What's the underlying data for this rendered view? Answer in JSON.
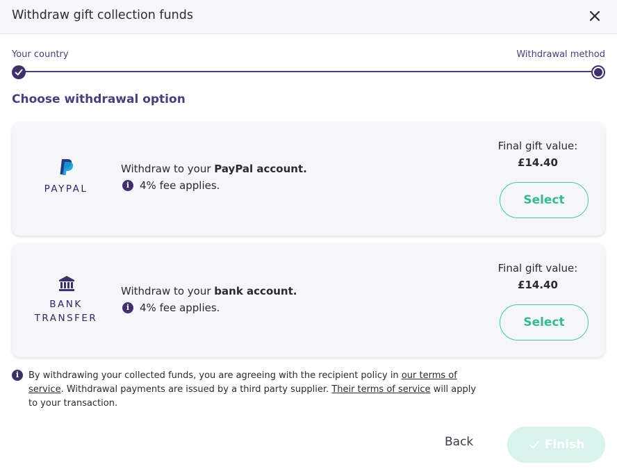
{
  "dialog": {
    "title": "Withdraw gift collection funds",
    "close_icon": "close-icon"
  },
  "stepper": {
    "steps": [
      {
        "label": "Your country",
        "state": "completed"
      },
      {
        "label": "Withdrawal method",
        "state": "current"
      }
    ]
  },
  "section_title": "Choose withdrawal option",
  "options": [
    {
      "logo_text": "PAYPAL",
      "logo_icon": "paypal-icon",
      "desc_prefix": "Withdraw to your ",
      "desc_bold": "PayPal account.",
      "fee_text": "4% fee applies.",
      "value_label": "Final gift value:",
      "value_amount": "£14.40",
      "select_label": "Select"
    },
    {
      "logo_text_line1": "BANK",
      "logo_text_line2": "TRANSFER",
      "logo_icon": "bank-icon",
      "desc_prefix": "Withdraw to your ",
      "desc_bold": "bank account.",
      "fee_text": "4% fee applies.",
      "value_label": "Final gift value:",
      "value_amount": "£14.40",
      "select_label": "Select"
    }
  ],
  "policy": {
    "part1": "By withdrawing your collected funds, you are agreeing with the recipient policy in ",
    "link1": "our terms of service",
    "part2": ". Withdrawal payments are issued by a third party supplier. ",
    "link2": "Their terms of service",
    "part3": " will apply to your transaction."
  },
  "footer": {
    "back_label": "Back",
    "finish_label": "Finish"
  },
  "colors": {
    "primary": "#3e3169",
    "accent": "#49c3a0",
    "finish_disabled": "#d9f3ec"
  }
}
